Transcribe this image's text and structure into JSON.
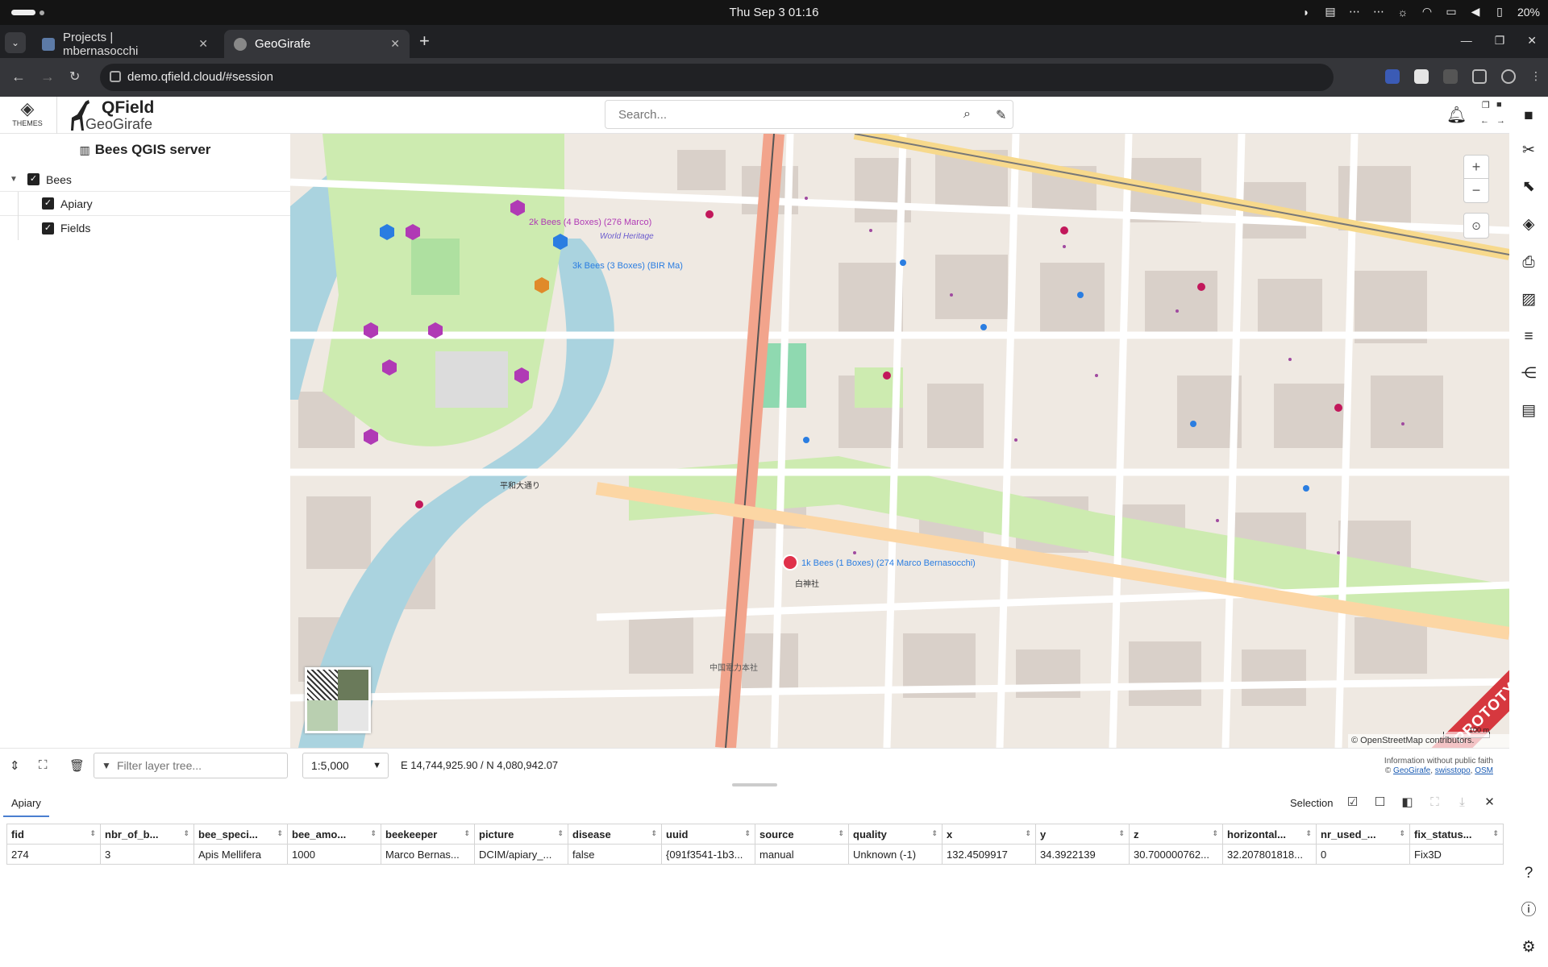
{
  "os": {
    "clock": "Thu Sep 3  01:16",
    "battery": "20%"
  },
  "browser": {
    "tabs": [
      {
        "title": "Projects | mbernasocchi",
        "active": false
      },
      {
        "title": "GeoGirafe",
        "active": true
      }
    ],
    "url": "demo.qfield.cloud/#session"
  },
  "header": {
    "themes_label": "THEMES",
    "logo_top": "QField",
    "logo_bottom": "GeoGirafe",
    "search_placeholder": "Search..."
  },
  "layer_tree": {
    "title": "Bees QGIS server",
    "items": [
      {
        "label": "Bees",
        "checked": true,
        "expanded": true
      },
      {
        "label": "Apiary",
        "checked": true
      },
      {
        "label": "Fields",
        "checked": true
      }
    ]
  },
  "map": {
    "labels": [
      "2k Bees (4 Boxes) (276 Marco)",
      "3k Bees (3 Boxes) (BIR Ma)",
      "1k Bees (1 Boxes) (274 Marco Bernasocchi)",
      "World Heritage",
      "平和大通り",
      "白神社",
      "中国電力本社",
      "PROTOTYPE"
    ],
    "scale_text": "100 m",
    "attribution": "© OpenStreetMap contributors.",
    "prototype": "PROTOTYPE"
  },
  "bottom_bar": {
    "filter_placeholder": "Filter layer tree...",
    "scale": "1:5,000",
    "coordinates": "E 14,744,925.90 / N 4,080,942.07",
    "info_line1": "Information without public faith",
    "info_line2_prefix": "© ",
    "info_links": [
      "GeoGirafe",
      "swisstopo",
      "OSM"
    ]
  },
  "attribute_table": {
    "tab_label": "Apiary",
    "selection_label": "Selection",
    "columns": [
      "fid",
      "nbr_of_b...",
      "bee_speci...",
      "bee_amo...",
      "beekeeper",
      "picture",
      "disease",
      "uuid",
      "source",
      "quality",
      "x",
      "y",
      "z",
      "horizontal...",
      "nr_used_...",
      "fix_status..."
    ],
    "rows": [
      [
        "274",
        "3",
        "Apis Mellifera",
        "1000",
        "Marco Bernas...",
        "DCIM/apiary_...",
        "false",
        "{091f3541-1b3...",
        "manual",
        "Unknown (-1)",
        "132.4509917",
        "34.3922139",
        "30.700000762...",
        "32.207801818...",
        "0",
        "Fix3D"
      ]
    ]
  },
  "colors": {
    "accent": "#4a7fd0",
    "prototype": "#d6383f",
    "bee_marker": "#b03ab5"
  }
}
